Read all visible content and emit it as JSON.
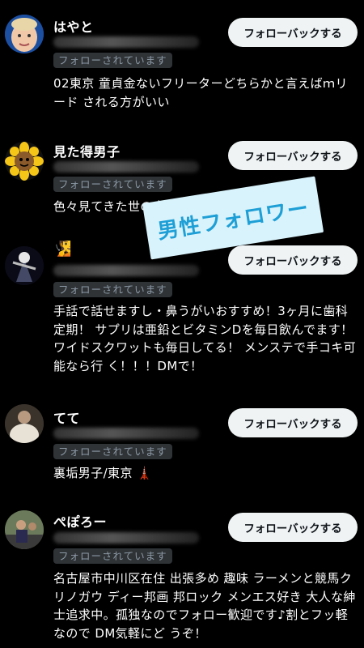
{
  "followers": [
    {
      "name": "はやと",
      "badge": "フォローされています",
      "button": "フォローバックする",
      "bio": "02東京 童貞金ないフリーターどちらかと言えばｍリード される方がいい"
    },
    {
      "name": "見た得男子",
      "badge": "フォローされています",
      "button": "フォローバックする",
      "bio": "色々見てきた世の中"
    },
    {
      "name": "",
      "badge": "フォローされています",
      "button": "フォローバックする",
      "bio": "手話で話せますし・鼻うがいおすすめ！3ヶ月に歯科定期！ サプリは亜鉛とビタミンDを毎日飲んでます！ワイドスクワットも毎日してる！ メンステで手コキ可能なら行 く！！！DMで！"
    },
    {
      "name": "てて",
      "badge": "フォローされています",
      "button": "フォローバックする",
      "bio": "裏垢男子/東京 🗼"
    },
    {
      "name": "ぺぽろー",
      "badge": "フォローされています",
      "button": "フォローバックする",
      "bio": "名古屋市中川区在住 出張多め 趣味 ラーメンと競馬クリノガウ ディー邦画 邦ロック メンエス好き 大人な紳士追求中。孤独なのでフォロー歓迎です♪割とフッ軽なので DM気軽にど うぞ！"
    }
  ],
  "overlay": {
    "label": "男性フォロワー"
  },
  "icons": {
    "badge_emoji": "🧏"
  }
}
